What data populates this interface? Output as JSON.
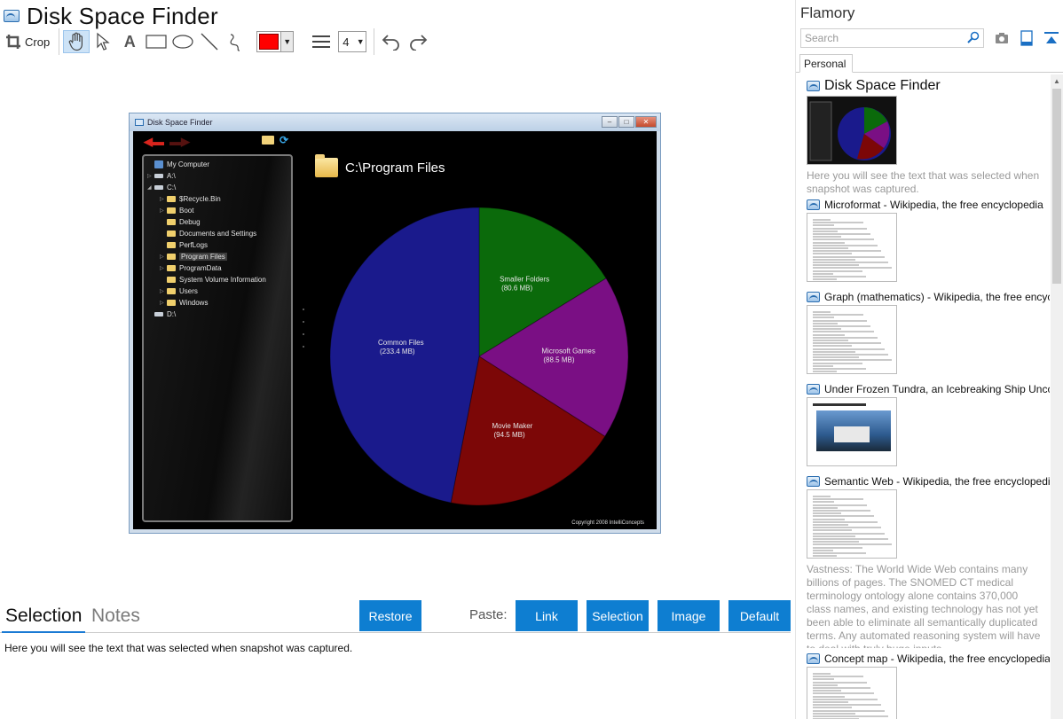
{
  "app": {
    "title": "Disk Space Finder",
    "icon": "flamory-snapshot-icon"
  },
  "toolbar": {
    "crop_label": "Crop",
    "tools": [
      "crop-icon",
      "hand-icon",
      "pointer-icon",
      "text-icon",
      "rectangle-icon",
      "ellipse-icon",
      "line-icon",
      "freehand-icon"
    ],
    "active_tool": "hand-icon",
    "pen_color": "#ff0000",
    "line_width": "4"
  },
  "preview": {
    "window_title": "Disk Space Finder",
    "path": "C:\\Program Files",
    "copyright": "Copyright 2008 IntelliConcepts",
    "tree": [
      {
        "label": "My Computer",
        "level": 0,
        "kind": "pc",
        "expander": ""
      },
      {
        "label": "A:\\",
        "level": 0,
        "kind": "drive",
        "expander": "▷"
      },
      {
        "label": "C:\\",
        "level": 0,
        "kind": "drive",
        "expander": "◢"
      },
      {
        "label": "$Recycle.Bin",
        "level": 1,
        "kind": "folder",
        "expander": "▷"
      },
      {
        "label": "Boot",
        "level": 1,
        "kind": "folder",
        "expander": "▷"
      },
      {
        "label": "Debug",
        "level": 1,
        "kind": "folder",
        "expander": ""
      },
      {
        "label": "Documents and Settings",
        "level": 1,
        "kind": "folder",
        "expander": ""
      },
      {
        "label": "PerfLogs",
        "level": 1,
        "kind": "folder",
        "expander": ""
      },
      {
        "label": "Program Files",
        "level": 1,
        "kind": "folder",
        "expander": "▷",
        "selected": true
      },
      {
        "label": "ProgramData",
        "level": 1,
        "kind": "folder",
        "expander": "▷"
      },
      {
        "label": "System Volume Information",
        "level": 1,
        "kind": "folder",
        "expander": ""
      },
      {
        "label": "Users",
        "level": 1,
        "kind": "folder",
        "expander": "▷"
      },
      {
        "label": "Windows",
        "level": 1,
        "kind": "folder",
        "expander": "▷"
      },
      {
        "label": "D:\\",
        "level": 0,
        "kind": "drive",
        "expander": ""
      }
    ]
  },
  "chart_data": {
    "type": "pie",
    "slices": [
      {
        "label": "Smaller Folders",
        "value_label": "(80.6 MB)",
        "value": 80.6,
        "color": "#0b6a0b"
      },
      {
        "label": "Microsoft Games",
        "value_label": "(88.5 MB)",
        "value": 88.5,
        "color": "#7a0f84"
      },
      {
        "label": "Movie Maker",
        "value_label": "(94.5 MB)",
        "value": 94.5,
        "color": "#7c0707"
      },
      {
        "label": "Common Files",
        "value_label": "(233.4 MB)",
        "value": 233.4,
        "color": "#1a1a8c"
      }
    ]
  },
  "bottom": {
    "tab_selection": "Selection",
    "tab_notes": "Notes",
    "restore_label": "Restore",
    "paste_label": "Paste:",
    "paste_buttons": [
      "Link",
      "Selection",
      "Image",
      "Default"
    ],
    "selection_text": "Here you will see the text that was selected when snapshot was captured."
  },
  "side": {
    "title": "Flamory",
    "search_placeholder": "Search",
    "tab_personal": "Personal",
    "icons": [
      "camera-icon",
      "page-icon",
      "collapse-icon"
    ],
    "entries": [
      {
        "title": "Disk Space Finder",
        "desc": "Here you will see the text that was selected when snapshot was captured.",
        "thumb": "dark"
      },
      {
        "title": "Microformat - Wikipedia, the free encyclopedia",
        "desc": "",
        "thumb": "doc"
      },
      {
        "title": "Graph (mathematics) - Wikipedia, the free encyclopedia",
        "desc": "",
        "thumb": "doc"
      },
      {
        "title": "Under Frozen Tundra, an Icebreaking Ship Uncovers",
        "desc": "",
        "thumb": "photo"
      },
      {
        "title": "Semantic Web - Wikipedia, the free encyclopedia",
        "desc": "Vastness: The World Wide Web contains many billions of pages. The SNOMED CT medical terminology ontology alone contains 370,000 class names, and existing technology has not yet been able to eliminate all semantically duplicated terms. Any automated reasoning system will have to deal with truly huge inputs.",
        "thumb": "doc"
      },
      {
        "title": "Concept map - Wikipedia, the free encyclopedia",
        "desc": "",
        "thumb": "doc"
      }
    ]
  }
}
